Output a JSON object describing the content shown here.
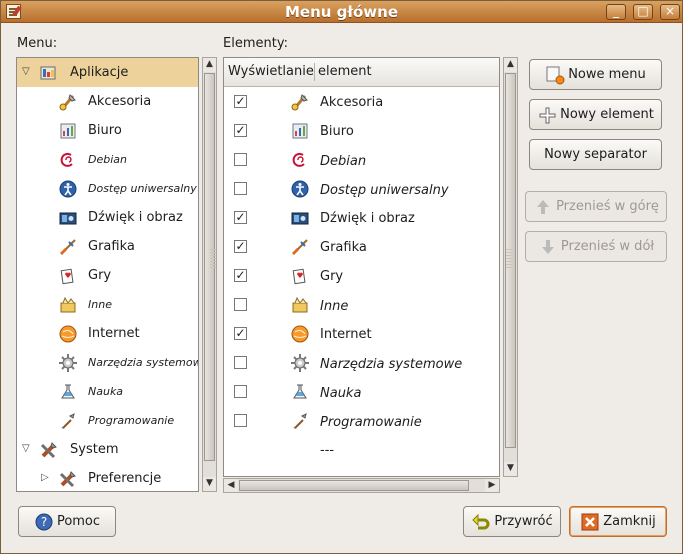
{
  "window": {
    "title": "Menu główne"
  },
  "labels": {
    "menu": "Menu:",
    "elements": "Elementy:"
  },
  "tree": [
    {
      "label": "Aplikacje",
      "icon": "applications-icon",
      "italic": false,
      "expander": "▽",
      "selected": true,
      "indent": 0
    },
    {
      "label": "Akcesoria",
      "icon": "accessories-icon",
      "italic": false,
      "expander": "",
      "selected": false,
      "indent": 1
    },
    {
      "label": "Biuro",
      "icon": "office-icon",
      "italic": false,
      "expander": "",
      "selected": false,
      "indent": 1
    },
    {
      "label": "Debian",
      "icon": "debian-icon",
      "italic": true,
      "expander": "",
      "selected": false,
      "indent": 1
    },
    {
      "label": "Dostęp uniwersalny",
      "icon": "accessibility-icon",
      "italic": true,
      "expander": "",
      "selected": false,
      "indent": 1
    },
    {
      "label": "Dźwięk i obraz",
      "icon": "multimedia-icon",
      "italic": false,
      "expander": "",
      "selected": false,
      "indent": 1
    },
    {
      "label": "Grafika",
      "icon": "graphics-icon",
      "italic": false,
      "expander": "",
      "selected": false,
      "indent": 1
    },
    {
      "label": "Gry",
      "icon": "games-icon",
      "italic": false,
      "expander": "",
      "selected": false,
      "indent": 1
    },
    {
      "label": "Inne",
      "icon": "other-icon",
      "italic": true,
      "expander": "",
      "selected": false,
      "indent": 1
    },
    {
      "label": "Internet",
      "icon": "internet-icon",
      "italic": false,
      "expander": "",
      "selected": false,
      "indent": 1
    },
    {
      "label": "Narzędzia systemowe",
      "icon": "system-tools-icon",
      "italic": true,
      "expander": "",
      "selected": false,
      "indent": 1
    },
    {
      "label": "Nauka",
      "icon": "science-icon",
      "italic": true,
      "expander": "",
      "selected": false,
      "indent": 1
    },
    {
      "label": "Programowanie",
      "icon": "programming-icon",
      "italic": true,
      "expander": "",
      "selected": false,
      "indent": 1
    },
    {
      "label": "System",
      "icon": "system-icon",
      "italic": false,
      "expander": "▽",
      "selected": false,
      "indent": 0
    },
    {
      "label": "Preferencje",
      "icon": "preferences-icon",
      "italic": false,
      "expander": "▷",
      "selected": false,
      "indent": 1
    }
  ],
  "elements_table": {
    "headers": [
      "Wyświetlanie",
      "element"
    ],
    "rows": [
      {
        "checked": true,
        "label": "Akcesoria",
        "icon": "accessories-icon",
        "italic": false
      },
      {
        "checked": true,
        "label": "Biuro",
        "icon": "office-icon",
        "italic": false
      },
      {
        "checked": false,
        "label": "Debian",
        "icon": "debian-icon",
        "italic": true
      },
      {
        "checked": false,
        "label": "Dostęp uniwersalny",
        "icon": "accessibility-icon",
        "italic": true
      },
      {
        "checked": true,
        "label": "Dźwięk i obraz",
        "icon": "multimedia-icon",
        "italic": false
      },
      {
        "checked": true,
        "label": "Grafika",
        "icon": "graphics-icon",
        "italic": false
      },
      {
        "checked": true,
        "label": "Gry",
        "icon": "games-icon",
        "italic": false
      },
      {
        "checked": false,
        "label": "Inne",
        "icon": "other-icon",
        "italic": true
      },
      {
        "checked": true,
        "label": "Internet",
        "icon": "internet-icon",
        "italic": false
      },
      {
        "checked": false,
        "label": "Narzędzia systemowe",
        "icon": "system-tools-icon",
        "italic": true
      },
      {
        "checked": false,
        "label": "Nauka",
        "icon": "science-icon",
        "italic": true
      },
      {
        "checked": false,
        "label": "Programowanie",
        "icon": "programming-icon",
        "italic": true
      },
      {
        "checked": null,
        "label": "---",
        "icon": "",
        "italic": false
      }
    ]
  },
  "buttons": {
    "new_menu": "Nowe menu",
    "new_element": "Nowy element",
    "new_separator": "Nowy separator",
    "move_up": "Przenieś w górę",
    "move_down": "Przenieś w dół",
    "help": "Pomoc",
    "restore": "Przywróć",
    "close": "Zamknij"
  },
  "colors": {
    "selection": "#edd29b",
    "title_orange": "#c97a36"
  }
}
